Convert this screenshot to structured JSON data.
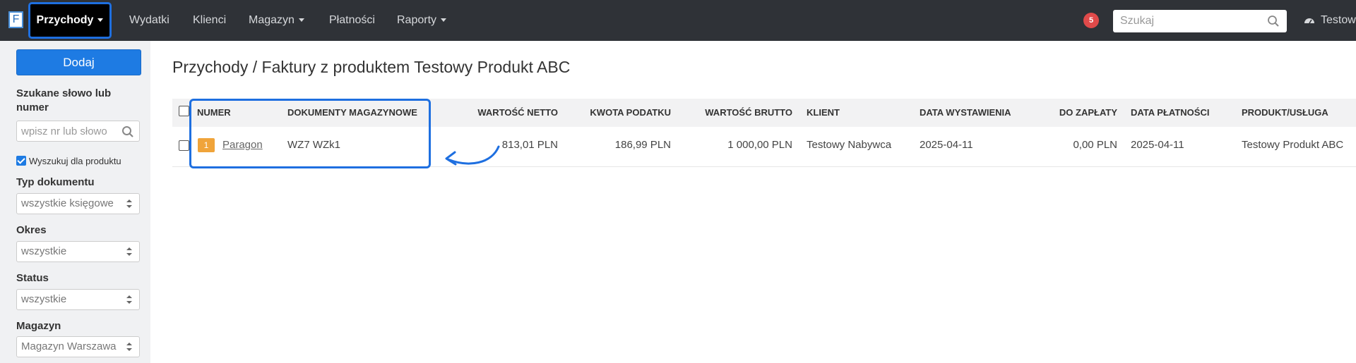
{
  "app": {
    "logo_letter": "F"
  },
  "nav": {
    "items": [
      {
        "label": "Przychody",
        "has_caret": true,
        "active": true
      },
      {
        "label": "Wydatki",
        "has_caret": false
      },
      {
        "label": "Klienci",
        "has_caret": false
      },
      {
        "label": "Magazyn",
        "has_caret": true
      },
      {
        "label": "Płatności",
        "has_caret": false
      },
      {
        "label": "Raporty",
        "has_caret": true
      }
    ],
    "notification_count": "5",
    "search_placeholder": "Szukaj",
    "user_label": "Testow"
  },
  "sidebar": {
    "add_button": "Dodaj",
    "search_label": "Szukane słowo lub numer",
    "search_placeholder": "wpisz nr lub słowo",
    "checkbox_label": "Wyszukuj dla produktu",
    "checkbox_checked": true,
    "filters": [
      {
        "label": "Typ dokumentu",
        "value": "wszystkie księgowe"
      },
      {
        "label": "Okres",
        "value": "wszystkie"
      },
      {
        "label": "Status",
        "value": "wszystkie"
      },
      {
        "label": "Magazyn",
        "value": "Magazyn Warszawa"
      }
    ]
  },
  "main": {
    "title": "Przychody / Faktury z produktem Testowy Produkt ABC",
    "columns": [
      "NUMER",
      "DOKUMENTY MAGAZYNOWE",
      "WARTOŚĆ NETTO",
      "KWOTA PODATKU",
      "WARTOŚĆ BRUTTO",
      "KLIENT",
      "DATA WYSTAWIENIA",
      "DO ZAPŁATY",
      "DATA PŁATNOŚCI",
      "PRODUKT/USŁUGA"
    ],
    "rows": [
      {
        "badge": "1",
        "number": "Paragon",
        "warehouse_docs": "WZ7 WZk1",
        "net": "813,01 PLN",
        "tax": "186,99 PLN",
        "gross": "1 000,00 PLN",
        "client": "Testowy Nabywca",
        "issue_date": "2025-04-11",
        "to_pay": "0,00 PLN",
        "payment_date": "2025-04-11",
        "product": "Testowy Produkt ABC"
      }
    ]
  },
  "colors": {
    "navbar_bg": "#2f3237",
    "accent": "#1e7be3",
    "annotation": "#1e6fe0",
    "badge_red": "#e04a4a",
    "badge_orange": "#f0a43a"
  }
}
